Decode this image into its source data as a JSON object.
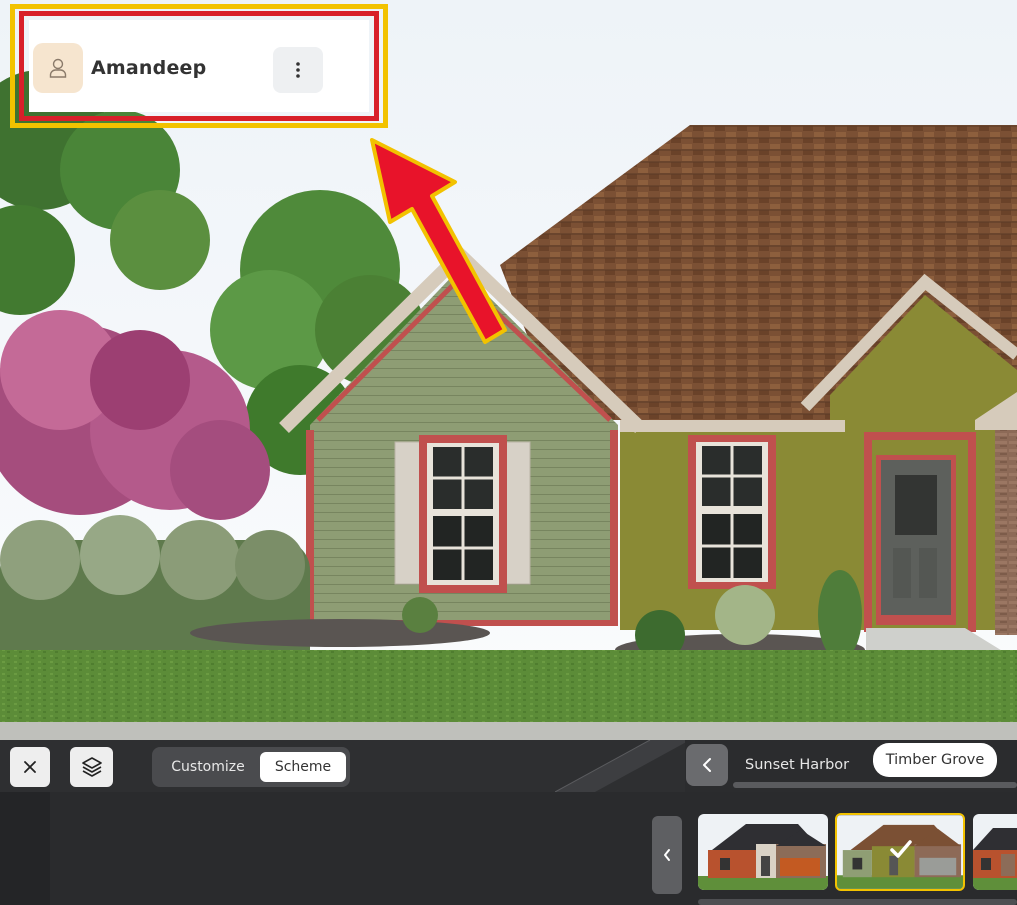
{
  "user": {
    "name": "Amandeep",
    "avatar_icon": "user-icon",
    "menu_icon": "kebab-menu-icon"
  },
  "annotation": {
    "border_color": "#f2c200",
    "inner_color": "#d8202a",
    "arrow_fill": "#e8132a",
    "arrow_outline": "#f2c200"
  },
  "toolbar": {
    "close_icon": "close-icon",
    "layers_icon": "layers-icon",
    "modes": [
      {
        "label": "Customize",
        "selected": false
      },
      {
        "label": "Scheme",
        "selected": true
      }
    ]
  },
  "schemes": {
    "prev_icon": "chevron-left-icon",
    "items": [
      {
        "label": "Sunset Harbor",
        "selected": false
      },
      {
        "label": "Timber Grove",
        "selected": true
      }
    ]
  },
  "thumbnails": {
    "prev_icon": "chevron-left-icon",
    "selected_index": 1,
    "selected_icon": "checkmark-icon",
    "accent": "#f2c200"
  },
  "colors": {
    "roof": "#7a4f33",
    "siding_left": "#8f9e74",
    "siding_right": "#8a8a35",
    "trim": "#c0504e",
    "toolbar_bg": "#2e2f31"
  }
}
